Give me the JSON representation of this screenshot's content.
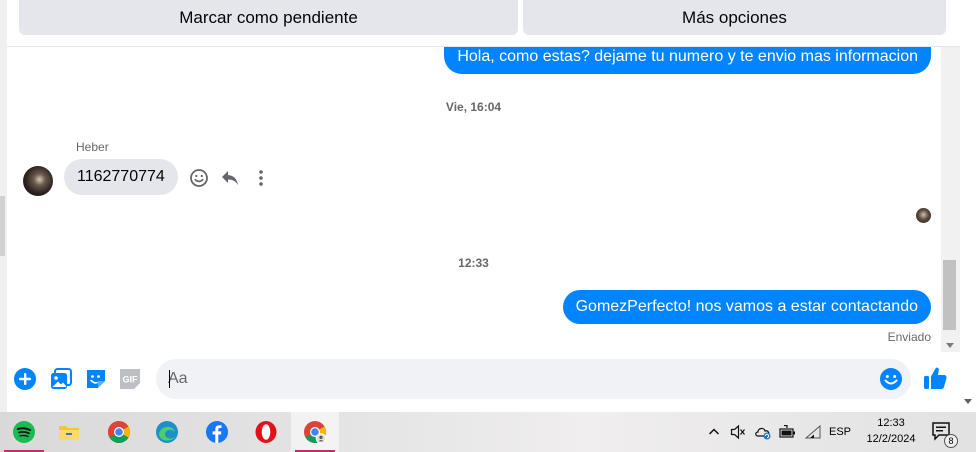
{
  "toolbar": {
    "mark_pending_label": "Marcar como pendiente",
    "more_options_label": "Más opciones"
  },
  "conversation": {
    "messages": [
      {
        "direction": "outgoing",
        "text": "Hola, como estas? dejame tu numero y te envio mas informacion"
      },
      {
        "type": "timestamp",
        "text": "Vie, 16:04"
      },
      {
        "direction": "incoming",
        "sender": "Heber",
        "text": "1162770774"
      },
      {
        "type": "timestamp",
        "text": "12:33"
      },
      {
        "direction": "outgoing",
        "text": "GomezPerfecto! nos vamos a estar contactando",
        "status": "Enviado"
      }
    ]
  },
  "composer": {
    "placeholder": "Aa",
    "value": ""
  },
  "colors": {
    "accent": "#0084ff",
    "incoming_bubble": "#e4e6eb",
    "muted_text": "#65676b",
    "taskbar_indicator": "#c42b6a"
  },
  "taskbar": {
    "apps": [
      "spotify-icon",
      "file-explorer-icon",
      "chrome-icon",
      "edge-icon",
      "facebook-icon",
      "opera-icon",
      "chrome-profile-icon"
    ],
    "tray": {
      "language": "ESP",
      "time": "12:33",
      "date": "12/2/2024",
      "notification_count": "8"
    }
  }
}
